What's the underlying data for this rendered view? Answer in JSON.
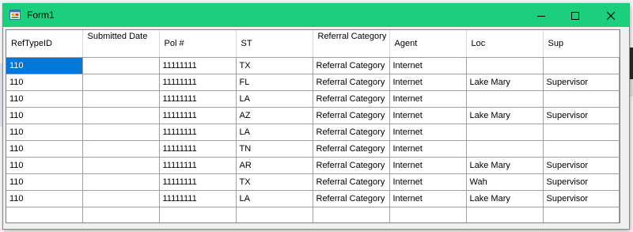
{
  "window": {
    "title": "Form1"
  },
  "grid": {
    "columns": [
      "RefTypeID",
      "Submitted Date",
      "Pol #",
      "ST",
      "Referral Category",
      "Agent",
      "Loc",
      "Sup"
    ],
    "rows": [
      [
        "110",
        "",
        "11111111",
        "TX",
        "Referral Category",
        "Internet",
        "",
        ""
      ],
      [
        "110",
        "",
        "11111111",
        "FL",
        "Referral Category",
        "Internet",
        "Lake Mary",
        "Supervisor"
      ],
      [
        "110",
        "",
        "11111111",
        "LA",
        "Referral Category",
        "Internet",
        "",
        ""
      ],
      [
        "110",
        "",
        "11111111",
        "AZ",
        "Referral Category",
        "Internet",
        "Lake Mary",
        "Supervisor"
      ],
      [
        "110",
        "",
        "11111111",
        "LA",
        "Referral Category",
        "Internet",
        "",
        ""
      ],
      [
        "110",
        "",
        "11111111",
        "TN",
        "Referral Category",
        "Internet",
        "",
        ""
      ],
      [
        "110",
        "",
        "11111111",
        "AR",
        "Referral Category",
        "Internet",
        "Lake Mary",
        "Supervisor"
      ],
      [
        "110",
        "",
        "11111111",
        "TX",
        "Referral Category",
        "Internet",
        "Wah",
        "Supervisor"
      ],
      [
        "110",
        "",
        "11111111",
        "LA",
        "Referral Category",
        "Internet",
        "Lake Mary",
        "Supervisor"
      ]
    ]
  },
  "colors": {
    "titlebar": "#1ccf7d",
    "selection": "#0078d7",
    "grid_background": "#ababab"
  },
  "icons": {
    "app": "form-app-icon",
    "minimize": "minimize-icon",
    "maximize": "maximize-icon",
    "close": "close-icon"
  }
}
